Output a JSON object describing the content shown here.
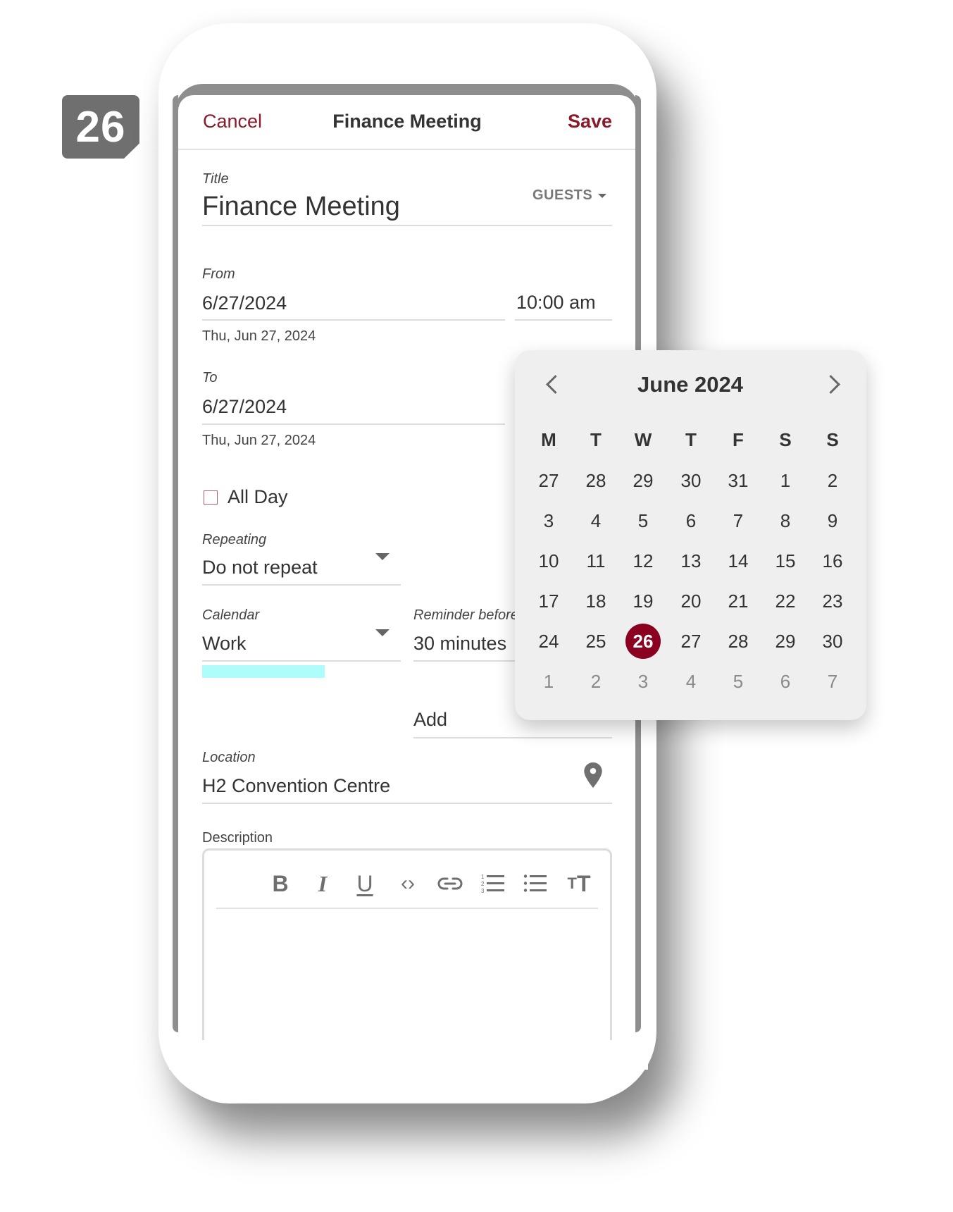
{
  "step_badge": "26",
  "header": {
    "cancel_label": "Cancel",
    "title": "Finance Meeting",
    "save_label": "Save"
  },
  "form": {
    "title": {
      "label": "Title",
      "value": "Finance Meeting"
    },
    "guests_label": "GUESTS",
    "from": {
      "label": "From",
      "date": "6/27/2024",
      "time": "10:00 am",
      "date_long": "Thu, Jun 27, 2024"
    },
    "to": {
      "label": "To",
      "date": "6/27/2024",
      "date_long": "Thu, Jun 27, 2024"
    },
    "all_day": {
      "label": "All Day",
      "checked": false
    },
    "repeating": {
      "label": "Repeating",
      "value": "Do not repeat"
    },
    "calendar": {
      "label": "Calendar",
      "value": "Work",
      "color": "#aefcfc"
    },
    "reminder": {
      "label": "Reminder before",
      "value": "30 minutes"
    },
    "add_label": "Add",
    "location": {
      "label": "Location",
      "value": "H2 Convention Centre",
      "icon": "map-pin-icon"
    },
    "description": {
      "label": "Description",
      "value": "",
      "toolbar": [
        {
          "name": "bold-icon",
          "glyph": "B"
        },
        {
          "name": "italic-icon",
          "glyph": "I"
        },
        {
          "name": "underline-icon",
          "glyph": "U"
        },
        {
          "name": "code-icon",
          "glyph": "‹›"
        },
        {
          "name": "link-icon",
          "glyph": "link"
        },
        {
          "name": "numbered-list-icon",
          "glyph": "ol"
        },
        {
          "name": "bulleted-list-icon",
          "glyph": "ul"
        },
        {
          "name": "text-size-icon",
          "glyph": "тT"
        }
      ]
    }
  },
  "date_picker": {
    "month_label": "June 2024",
    "prev_icon": "chevron-left-icon",
    "next_icon": "chevron-right-icon",
    "weekdays": [
      "M",
      "T",
      "W",
      "T",
      "F",
      "S",
      "S"
    ],
    "weeks": [
      [
        {
          "d": "27"
        },
        {
          "d": "28"
        },
        {
          "d": "29"
        },
        {
          "d": "30"
        },
        {
          "d": "31"
        },
        {
          "d": "1"
        },
        {
          "d": "2"
        }
      ],
      [
        {
          "d": "3"
        },
        {
          "d": "4"
        },
        {
          "d": "5"
        },
        {
          "d": "6"
        },
        {
          "d": "7"
        },
        {
          "d": "8"
        },
        {
          "d": "9"
        }
      ],
      [
        {
          "d": "10"
        },
        {
          "d": "11"
        },
        {
          "d": "12"
        },
        {
          "d": "13"
        },
        {
          "d": "14"
        },
        {
          "d": "15"
        },
        {
          "d": "16"
        }
      ],
      [
        {
          "d": "17"
        },
        {
          "d": "18"
        },
        {
          "d": "19"
        },
        {
          "d": "20"
        },
        {
          "d": "21"
        },
        {
          "d": "22"
        },
        {
          "d": "23"
        }
      ],
      [
        {
          "d": "24"
        },
        {
          "d": "25"
        },
        {
          "d": "26",
          "selected": true
        },
        {
          "d": "27"
        },
        {
          "d": "28"
        },
        {
          "d": "29"
        },
        {
          "d": "30"
        }
      ],
      [
        {
          "d": "1",
          "muted": true
        },
        {
          "d": "2",
          "muted": true
        },
        {
          "d": "3",
          "muted": true
        },
        {
          "d": "4",
          "muted": true
        },
        {
          "d": "5",
          "muted": true
        },
        {
          "d": "6",
          "muted": true
        },
        {
          "d": "7",
          "muted": true
        }
      ]
    ]
  },
  "colors": {
    "accent": "#8b1a2b",
    "selected_day": "#8b0020",
    "popup_bg": "#efefef"
  }
}
